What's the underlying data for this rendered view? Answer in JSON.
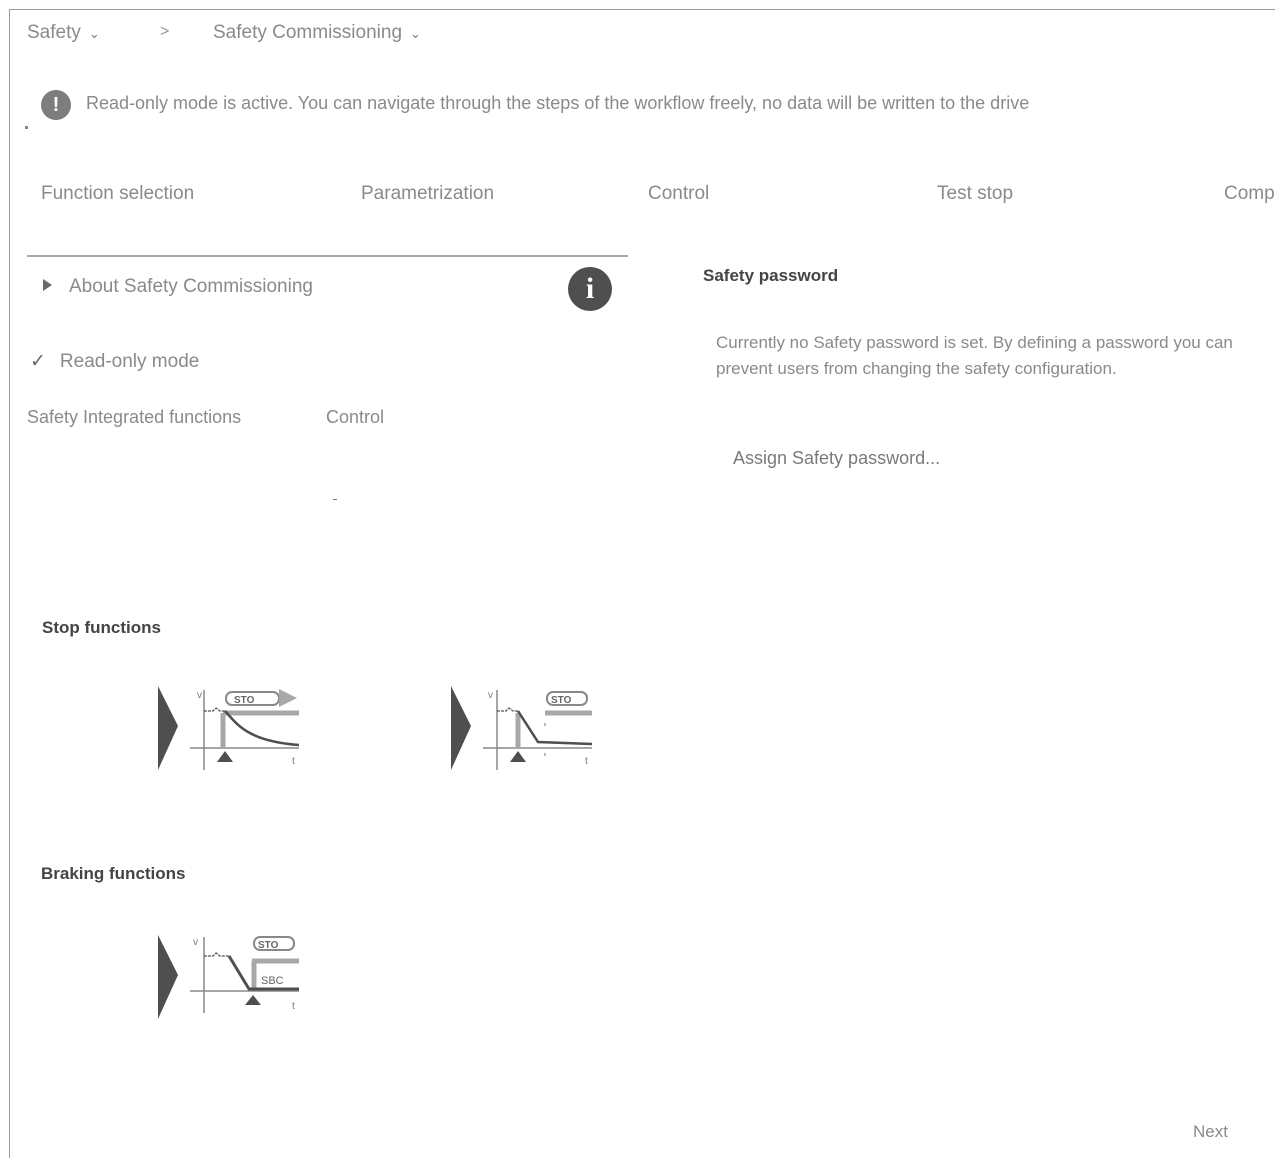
{
  "breadcrumb": {
    "root": "Safety",
    "separator": ">",
    "current": "Safety Commissioning"
  },
  "notice": {
    "icon": "exclamation-icon",
    "text": "Read-only mode is active. You can navigate through the steps of the workflow freely, no data will be written to the drive"
  },
  "steps": [
    {
      "label": "Function selection"
    },
    {
      "label": "Parametrization"
    },
    {
      "label": "Control"
    },
    {
      "label": "Test stop"
    },
    {
      "label": "Comp"
    }
  ],
  "left_panel": {
    "about_label": "About Safety Commissioning",
    "readonly_label": "Read-only mode",
    "subtabs": [
      {
        "label": "Safety Integrated functions"
      },
      {
        "label": "Control"
      }
    ],
    "stop_functions_title": "Stop functions",
    "stop_tiles": [
      {
        "badge": "STO",
        "v": "v",
        "t": "t"
      },
      {
        "badge": "STO",
        "v": "v",
        "t": "t"
      }
    ],
    "braking_functions_title": "Braking functions",
    "braking_tiles": [
      {
        "badge": "STO",
        "badge2": "SBC",
        "v": "v",
        "t": "t"
      }
    ]
  },
  "right_panel": {
    "title": "Safety password",
    "description": "Currently no Safety password is set. By defining a password you can prevent users from changing the safety configuration.",
    "link": "Assign Safety password..."
  },
  "footer": {
    "next_label": "Next"
  },
  "colors": {
    "icon_dark": "#4f4f4f",
    "text_gray": "#8a8a8a",
    "accent_gray": "#a8a8a8"
  }
}
